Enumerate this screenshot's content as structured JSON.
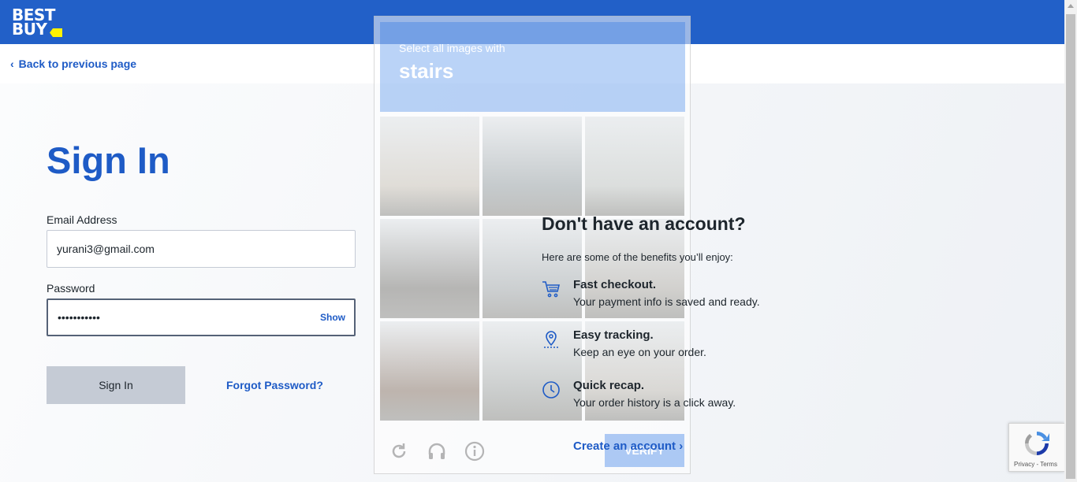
{
  "brand": {
    "line1": "BEST",
    "line2": "BUY"
  },
  "nav": {
    "back_label": "Back to previous page"
  },
  "signin": {
    "title": "Sign In",
    "email_label": "Email Address",
    "email_value": "yurani3@gmail.com",
    "password_label": "Password",
    "password_value": "•••••••••••",
    "show_label": "Show",
    "submit_label": "Sign In",
    "forgot_label": "Forgot Password?"
  },
  "promo": {
    "title": "Don't have an account?",
    "subtitle": "Here are some of the benefits you’ll enjoy:",
    "benefits": [
      {
        "title": "Fast checkout.",
        "desc": "Your payment info is saved and ready.",
        "icon": "cart-icon"
      },
      {
        "title": "Easy tracking.",
        "desc": "Keep an eye on your order.",
        "icon": "location-pin-icon"
      },
      {
        "title": "Quick recap.",
        "desc": "Your order history is a click away.",
        "icon": "clock-icon"
      }
    ],
    "create_label": "Create an account"
  },
  "captcha": {
    "instruction": "Select all images with",
    "target": "stairs",
    "verify_label": "VERIFY",
    "tile_colors": [
      "#c9c3b8",
      "#9aa3a6",
      "#c2c6c3",
      "#7d7c78",
      "#a6acae",
      "#b1aea8",
      "#8b7a6d",
      "#a5a9a7",
      "#bfbbb4"
    ]
  },
  "recaptcha": {
    "links": "Privacy - Terms"
  },
  "colors": {
    "brand_blue": "#2260c8",
    "link_blue": "#1e5bc6",
    "tag_yellow": "#fff200"
  }
}
